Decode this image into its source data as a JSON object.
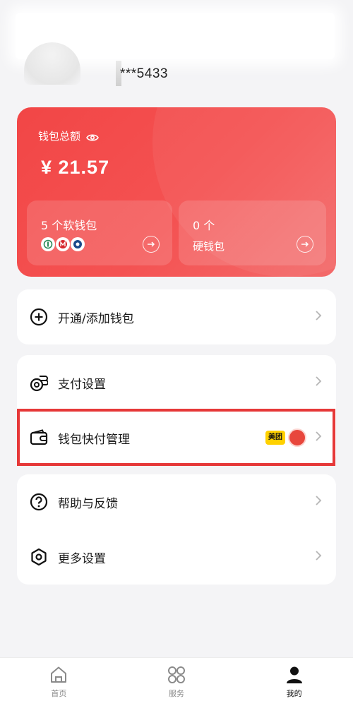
{
  "profile": {
    "phone_masked": "***5433"
  },
  "wallet": {
    "total_label": "钱包总额",
    "amount": "¥ 21.57",
    "soft": {
      "count": "5 个软钱包"
    },
    "hard": {
      "count": "0 个",
      "name": "硬钱包"
    },
    "accent": "#f24646"
  },
  "menu": {
    "open_wallet": "开通/添加钱包",
    "pay_settings": "支付设置",
    "quick_pay": "钱包快付管理",
    "quick_pay_badge": "美团",
    "help": "帮助与反馈",
    "more": "更多设置"
  },
  "tabs": [
    {
      "label": "首页",
      "icon": "home-icon"
    },
    {
      "label": "服务",
      "icon": "services-icon"
    },
    {
      "label": "我的",
      "icon": "profile-icon"
    }
  ],
  "highlight_color": "#e63838"
}
